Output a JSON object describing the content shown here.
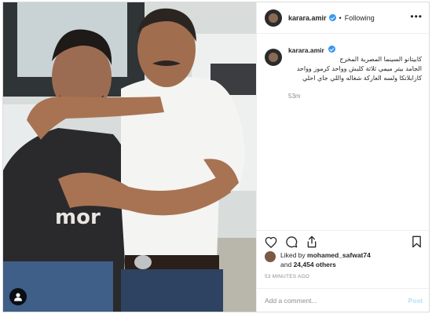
{
  "post": {
    "username": "karara.amir",
    "follow_status": "Following",
    "separator": "•",
    "caption_username": "karara.amir",
    "caption_line1": "كابيتانو السينما المصرية المخرج",
    "caption_line2": "الجامد بيتر ميمي ثلاثة كلبش وواحد كرموز وواحد",
    "caption_line3": "كازابلانكا ولسه العاركة شغاله واللي جاي احلي",
    "caption_age": "53m",
    "photo_text": "mor",
    "liked_by_prefix": "Liked by",
    "liked_by_user": "mohamed_safwat74",
    "liked_by_and": "and",
    "liked_by_count": "24,454 others",
    "post_time": "53 MINUTES AGO",
    "comment_placeholder": "Add a comment...",
    "post_button_label": "Post"
  },
  "icons": {
    "header_more": "more-icon",
    "like": "heart-icon",
    "comment": "comment-icon",
    "share": "share-icon",
    "save": "bookmark-icon",
    "photo_tag": "user-tag-icon"
  },
  "colors": {
    "verified": "#3897f0",
    "muted": "#8e8e8e",
    "post_button": "#b2dffc",
    "border": "#dbdbdb"
  }
}
